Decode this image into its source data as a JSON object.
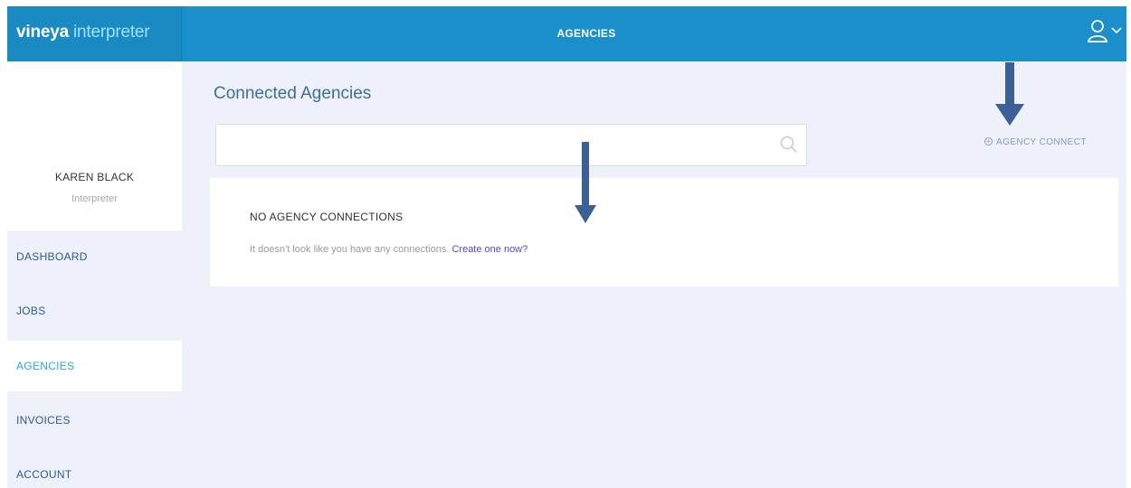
{
  "brand": {
    "bold": "vineya",
    "light": " interpreter"
  },
  "header": {
    "title": "AGENCIES",
    "user_icon": "user-icon",
    "dropdown_icon": "chevron-down-icon"
  },
  "profile": {
    "name": "KAREN BLACK",
    "role": "Interpreter"
  },
  "nav": {
    "items": [
      {
        "label": "DASHBOARD"
      },
      {
        "label": "JOBS"
      },
      {
        "label": "AGENCIES",
        "active": true
      },
      {
        "label": "INVOICES"
      },
      {
        "label": "ACCOUNT"
      }
    ]
  },
  "main": {
    "title": "Connected Agencies",
    "search": {
      "placeholder": "",
      "value": "",
      "icon": "search-icon"
    },
    "connect_button": {
      "label": "AGENCY CONNECT",
      "icon": "plus-circle-icon"
    },
    "empty_state": {
      "title": "NO AGENCY CONNECTIONS",
      "text": "It doesn't look like you have any connections. ",
      "link": "Create one now?"
    }
  },
  "colors": {
    "header_bg": "#1b8fca",
    "brand_light": "#9fe3f7",
    "nav_active": "#26a9dc",
    "nav_text": "#2d5b8e",
    "link": "#5546c8",
    "arrow": "#3c5f96",
    "page_bg": "#eef0fa"
  }
}
